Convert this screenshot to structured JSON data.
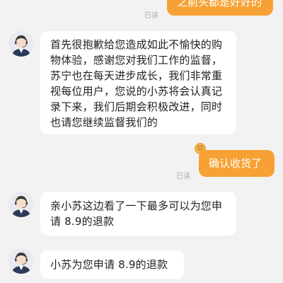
{
  "messages": [
    {
      "side": "out",
      "text": "之前头都是好好的",
      "read": "已读"
    },
    {
      "side": "in",
      "text_lines": [
        "首先很抱歉给您造成如此不愉快的购",
        "物体验，感谢您对我们工作的监督，",
        "苏宁也在每天进步成长，我们非常重",
        "视每位用户，您说的小苏将会认真记",
        "录下来，我们后期会积极改进，同时",
        "也请您继续监督我们的"
      ]
    },
    {
      "side": "out",
      "text": "确认收货了",
      "read": "已读"
    },
    {
      "side": "in",
      "text_lines": [
        "亲小苏这边看了一下最多可以为您申",
        "请 8.9的退款"
      ]
    },
    {
      "side": "in",
      "text_lines": [
        "小苏为您申请 8.9的退款"
      ]
    }
  ],
  "icons": {
    "agent_avatar": "customer-service-agent-avatar-icon",
    "emoji": "emoji-icon"
  },
  "colors": {
    "background": "#f2f2f2",
    "outgoing_bubble": "#f7a134",
    "incoming_bubble": "#ffffff",
    "read_receipt": "#a8a8a8"
  }
}
